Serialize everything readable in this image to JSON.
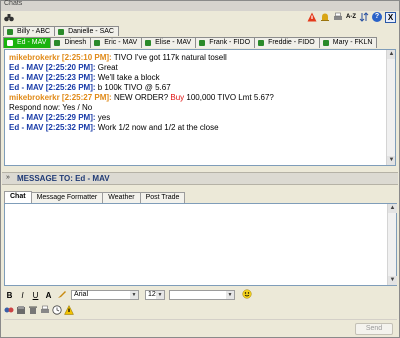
{
  "window": {
    "title": "Chats"
  },
  "toolbar": {
    "icons": [
      "warning-icon",
      "bell-icon",
      "print-icon",
      "sort-az-icon",
      "arrows-icon",
      "help-icon"
    ],
    "sort_label": "A-Z",
    "help_label": "?",
    "close_label": "X"
  },
  "tabs_row1": [
    {
      "label": "Billy - ABC"
    },
    {
      "label": "Danielle - SAC"
    }
  ],
  "tabs_row2": [
    {
      "label": "Ed - MAV",
      "active": true
    },
    {
      "label": "Dinesh"
    },
    {
      "label": "Eric - MAV"
    },
    {
      "label": "Elise - MAV"
    },
    {
      "label": "Frank - FIDO"
    },
    {
      "label": "Freddie - FIDO"
    },
    {
      "label": "Mary - FKLN"
    }
  ],
  "chat": {
    "lines": [
      {
        "sender": "mikebrokerkr [2:25:10 PM]:",
        "type": "me",
        "text": " TIVO I've got 117k natural tosell"
      },
      {
        "sender": "Ed - MAV [2:25:20 PM]:",
        "type": "ed",
        "text": " Great"
      },
      {
        "sender": "Ed - MAV [2:25:23 PM]:",
        "type": "ed",
        "text": " We'll take a block"
      },
      {
        "sender": "Ed - MAV [2:25:26 PM]:",
        "type": "ed",
        "text": " b 100k TIVO @ 5.67"
      },
      {
        "sender": "mikebrokerkr [2:25:27 PM]:",
        "type": "me",
        "text_pre": " NEW ORDER? ",
        "buy": "Buy",
        "text_post": " 100,000 TIVO Lmt 5.67?"
      },
      {
        "sender": "",
        "type": "plain",
        "text": "Respond now: Yes / No"
      },
      {
        "sender": "Ed - MAV [2:25:29 PM]:",
        "type": "ed",
        "text": " yes"
      },
      {
        "sender": "Ed - MAV [2:25:32 PM]:",
        "type": "ed",
        "text": " Work 1/2 now and 1/2 at the close"
      }
    ]
  },
  "message_to": {
    "label": "MESSAGE TO:  Ed - MAV"
  },
  "compose_tabs": [
    {
      "label": "Chat",
      "active": true
    },
    {
      "label": "Message Formatter"
    },
    {
      "label": "Weather"
    },
    {
      "label": "Post Trade"
    }
  ],
  "format": {
    "bold": "B",
    "italic": "I",
    "underline": "U",
    "font_color": "A",
    "font_family": "Arial",
    "font_size": "12"
  },
  "send_label": "Send",
  "colors": {
    "active_tab": "#19b30e",
    "ed": "#1a3ca8",
    "me": "#e08a18",
    "buy": "#dd1111"
  }
}
